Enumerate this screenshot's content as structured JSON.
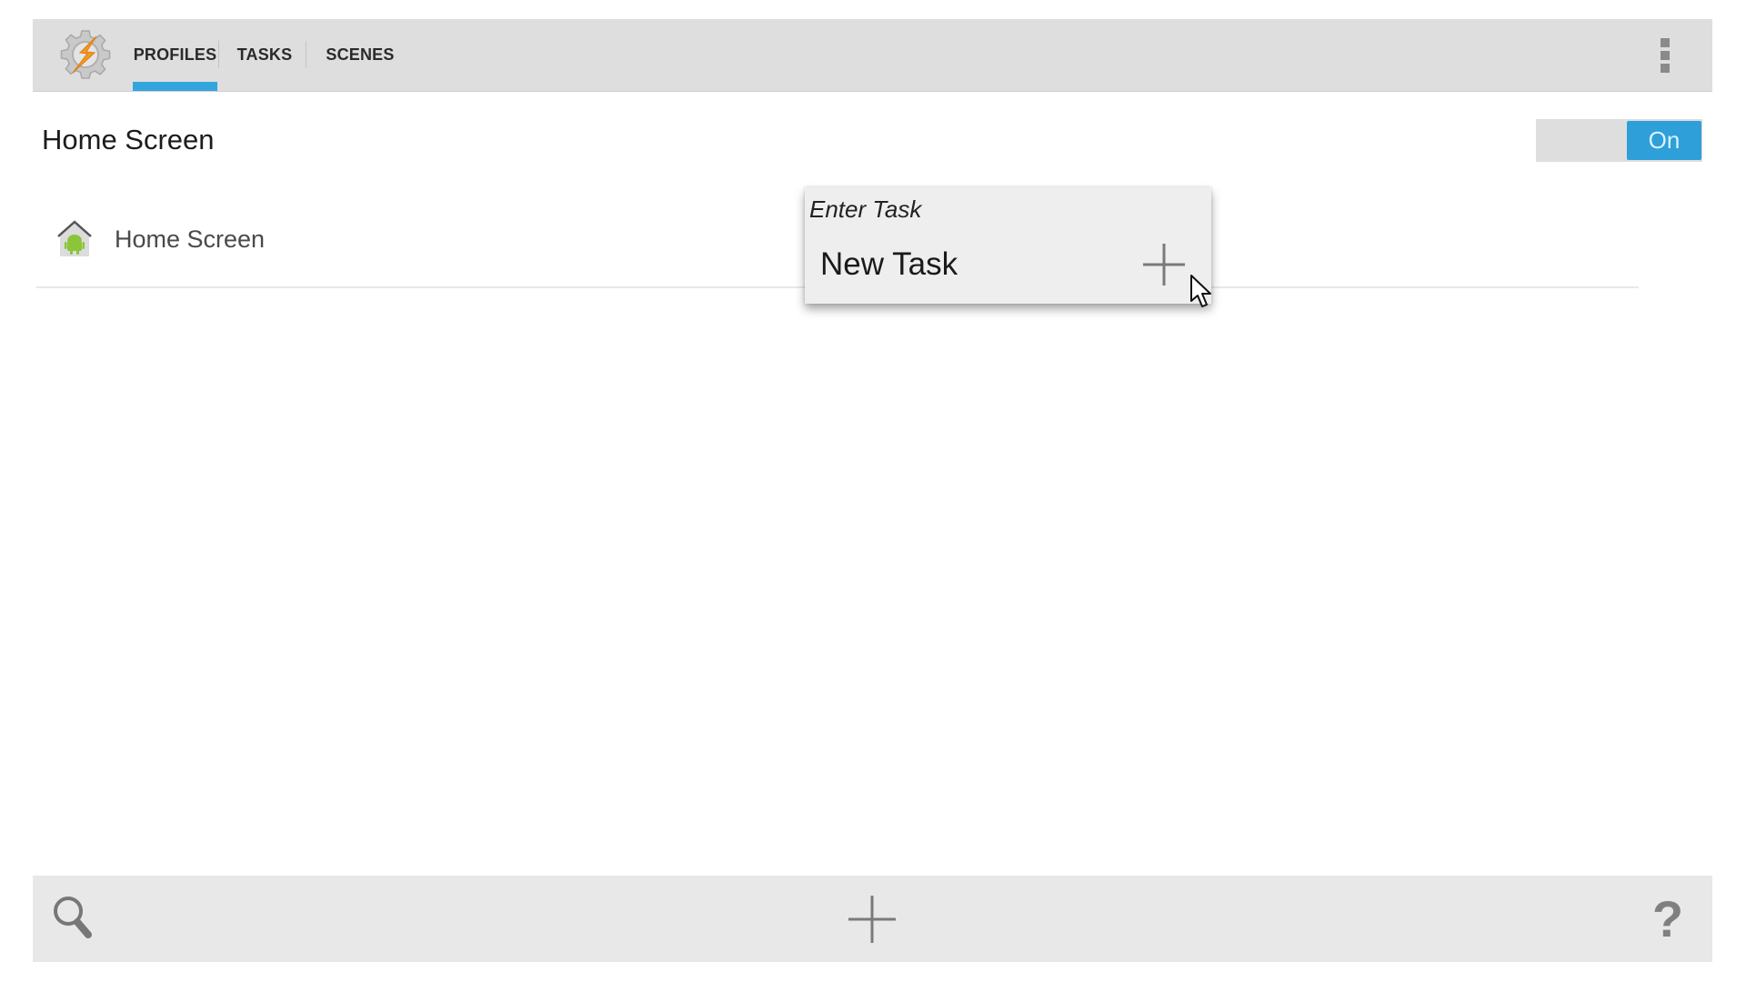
{
  "app": {
    "logo_icon": "tasker-gear-bolt-icon"
  },
  "tabs": [
    {
      "label": "PROFILES",
      "active": true
    },
    {
      "label": "TASKS",
      "active": false
    },
    {
      "label": "SCENES",
      "active": false
    }
  ],
  "header": {
    "overflow_icon": "more-vertical-icon",
    "accent_color": "#33a5dd"
  },
  "profile": {
    "title": "Home Screen",
    "toggle_label": "On",
    "toggle_state": true,
    "context": {
      "icon": "home-screen-icon",
      "label": "Home Screen"
    }
  },
  "task_popup": {
    "title": "Enter Task",
    "items": [
      {
        "label": "New Task",
        "action_icon": "plus-icon"
      }
    ]
  },
  "bottom_bar": {
    "search_icon": "search-icon",
    "add_icon": "plus-icon",
    "help_label": "?"
  }
}
